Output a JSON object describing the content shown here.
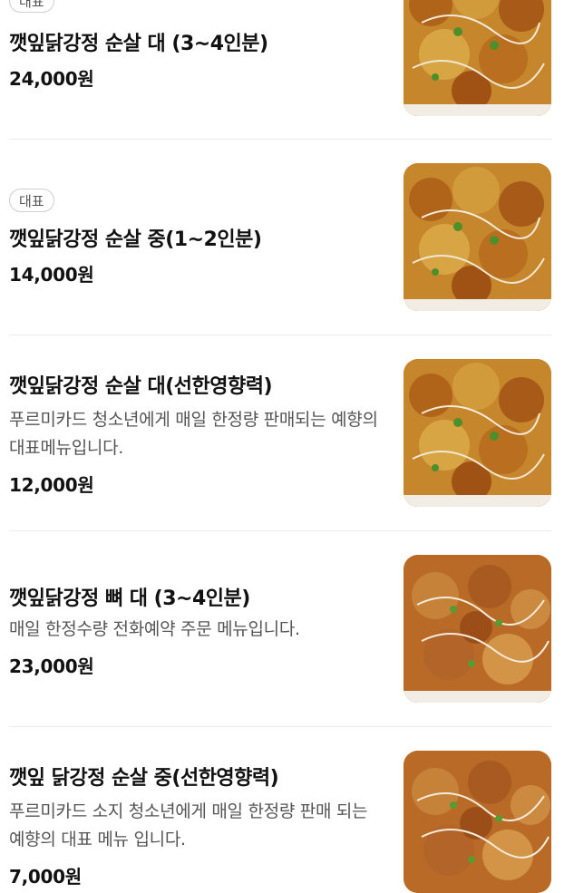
{
  "menu": {
    "items": [
      {
        "badge": "대표",
        "name": "깻잎닭강정 순살 대 (3~4인분)",
        "desc": "",
        "price": "24,000원",
        "image": "sweet-crispy-chicken-food-photo"
      },
      {
        "badge": "대표",
        "name": "깻잎닭강정 순살 중(1~2인분)",
        "desc": "",
        "price": "14,000원",
        "image": "sweet-crispy-chicken-food-photo"
      },
      {
        "badge": "",
        "name": "깻잎닭강정 순살 대(선한영향력)",
        "desc": "푸르미카드 청소년에게 매일 한정량 판매되는 예향의 대표메뉴입니다.",
        "price": "12,000원",
        "image": "sweet-crispy-chicken-food-photo"
      },
      {
        "badge": "",
        "name": "깻잎닭강정 뼈 대 (3~4인분)",
        "desc": "매일 한정수량 전화예약 주문 메뉴입니다.",
        "price": "23,000원",
        "image": "bone-in-chicken-food-photo"
      },
      {
        "badge": "",
        "name": "깻잎 닭강정 순살 중(선한영향력)",
        "desc": "푸르미카드 소지 청소년에게 매일 한정량 판매 되는 예향의 대표 메뉴 입니다.",
        "price": "7,000원",
        "image": "bone-in-chicken-food-photo"
      }
    ]
  }
}
